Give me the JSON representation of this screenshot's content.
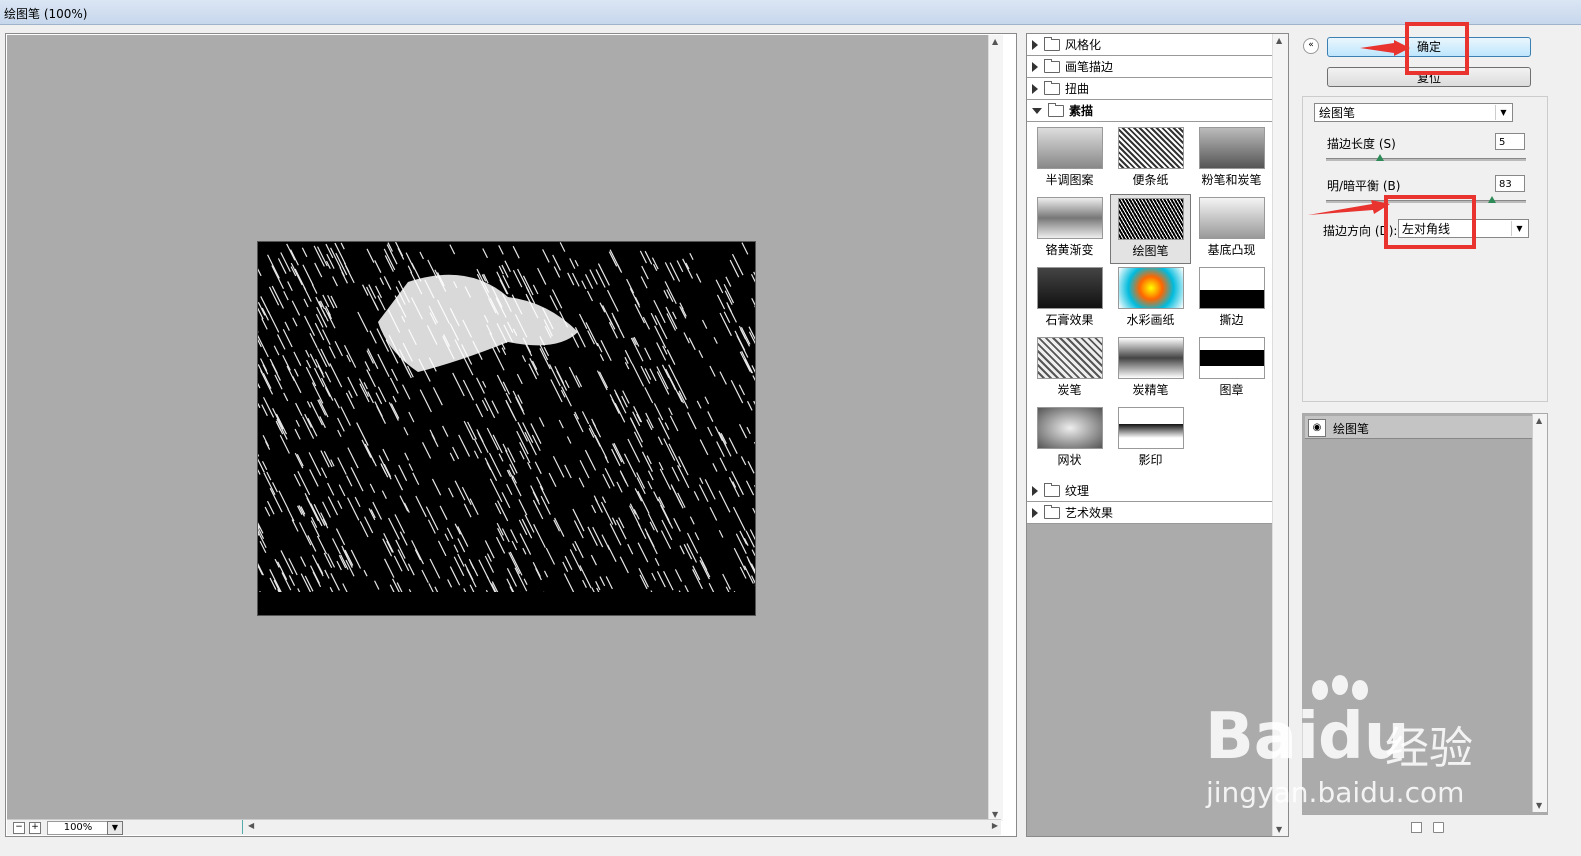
{
  "window": {
    "title": "绘图笔 (100%)"
  },
  "preview": {
    "zoom_value": "100%",
    "zoom_out": "−",
    "zoom_in": "+"
  },
  "gallery": {
    "categories_top": [
      {
        "label": "风格化",
        "open": false
      },
      {
        "label": "画笔描边",
        "open": false
      },
      {
        "label": "扭曲",
        "open": false
      },
      {
        "label": "素描",
        "open": true
      }
    ],
    "sketch_filters": [
      {
        "label": "半调图案"
      },
      {
        "label": "便条纸"
      },
      {
        "label": "粉笔和炭笔"
      },
      {
        "label": "铬黄渐变"
      },
      {
        "label": "绘图笔"
      },
      {
        "label": "基底凸现"
      },
      {
        "label": "石膏效果"
      },
      {
        "label": "水彩画纸"
      },
      {
        "label": "撕边"
      },
      {
        "label": "炭笔"
      },
      {
        "label": "炭精笔"
      },
      {
        "label": "图章"
      },
      {
        "label": "网状"
      },
      {
        "label": "影印"
      }
    ],
    "selected_filter": "绘图笔",
    "categories_bottom": [
      {
        "label": "纹理"
      },
      {
        "label": "艺术效果"
      }
    ]
  },
  "buttons": {
    "confirm": "确定",
    "reset": "复位",
    "collapse": "«"
  },
  "settings": {
    "filter_select": "绘图笔",
    "stroke_length_label": "描边长度 (S)",
    "stroke_length_value": "5",
    "stroke_length_fraction": 0.27,
    "balance_label": "明/暗平衡 (B)",
    "balance_value": "83",
    "balance_fraction": 0.83,
    "direction_label": "描边方向 (D):",
    "direction_value": "左对角线"
  },
  "layers": {
    "items": [
      {
        "label": "绘图笔"
      }
    ]
  },
  "watermark": {
    "brand": "Bai",
    "brand2": "du",
    "product": "经验",
    "url": "jingyan.baidu.com"
  }
}
